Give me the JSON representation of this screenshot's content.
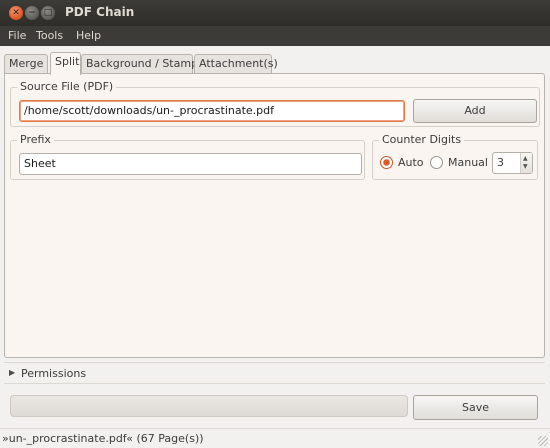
{
  "window": {
    "title": "PDF Chain",
    "close_glyph": "✕",
    "minimize_glyph": "−",
    "maximize_glyph": "□"
  },
  "menubar": {
    "items": [
      "File",
      "Tools",
      "Help"
    ]
  },
  "tabs": [
    {
      "label": "Merge",
      "active": false
    },
    {
      "label": "Split",
      "active": true
    },
    {
      "label": "Background / Stamp",
      "active": false
    },
    {
      "label": "Attachment(s)",
      "active": false
    }
  ],
  "source": {
    "label": "Source File (PDF)",
    "value": "/home/scott/downloads/un-_procrastinate.pdf",
    "add_label": "Add"
  },
  "prefix": {
    "label": "Prefix",
    "value": "Sheet"
  },
  "counter": {
    "label": "Counter Digits",
    "auto_label": "Auto",
    "manual_label": "Manual",
    "selected": "auto",
    "digits": "3"
  },
  "permissions": {
    "label": "Permissions",
    "expanded": false
  },
  "progress": {
    "fraction": 0
  },
  "save_label": "Save",
  "status": "»un-_procrastinate.pdf« (67 Page(s))",
  "colors": {
    "accent": "#e07b4a",
    "titlebar": "#3c3b37",
    "panel": "#fbf5f1"
  }
}
